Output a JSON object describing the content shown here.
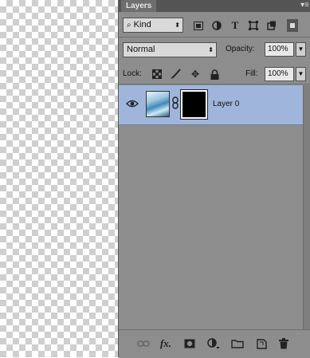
{
  "panel": {
    "tab_label": "Layers",
    "menu_icon": "panel-menu-icon"
  },
  "filter": {
    "kind_label": "Kind",
    "search_icon": "search-icon",
    "icons": [
      "image-filter-icon",
      "adjustment-filter-icon",
      "type-filter-icon",
      "shape-filter-icon",
      "smart-object-filter-icon",
      "filter-toggle-icon"
    ]
  },
  "blend": {
    "mode": "Normal",
    "opacity_label": "Opacity:",
    "opacity_value": "100%"
  },
  "lock": {
    "label": "Lock:",
    "icons": [
      "lock-transparent-icon",
      "lock-image-icon",
      "lock-position-icon",
      "lock-all-icon"
    ],
    "fill_label": "Fill:",
    "fill_value": "100%"
  },
  "layers": [
    {
      "name": "Layer 0",
      "visible": true,
      "selected": true,
      "has_mask": true
    }
  ],
  "footer": {
    "icons": [
      "link-layers-icon",
      "fx-icon",
      "add-mask-icon",
      "adjustment-layer-icon",
      "new-group-icon",
      "new-layer-icon",
      "delete-layer-icon"
    ]
  },
  "colors": {
    "panel_bg": "#8d8d8d",
    "selected_row": "#9fb5dc",
    "tab_bg": "#545454"
  }
}
